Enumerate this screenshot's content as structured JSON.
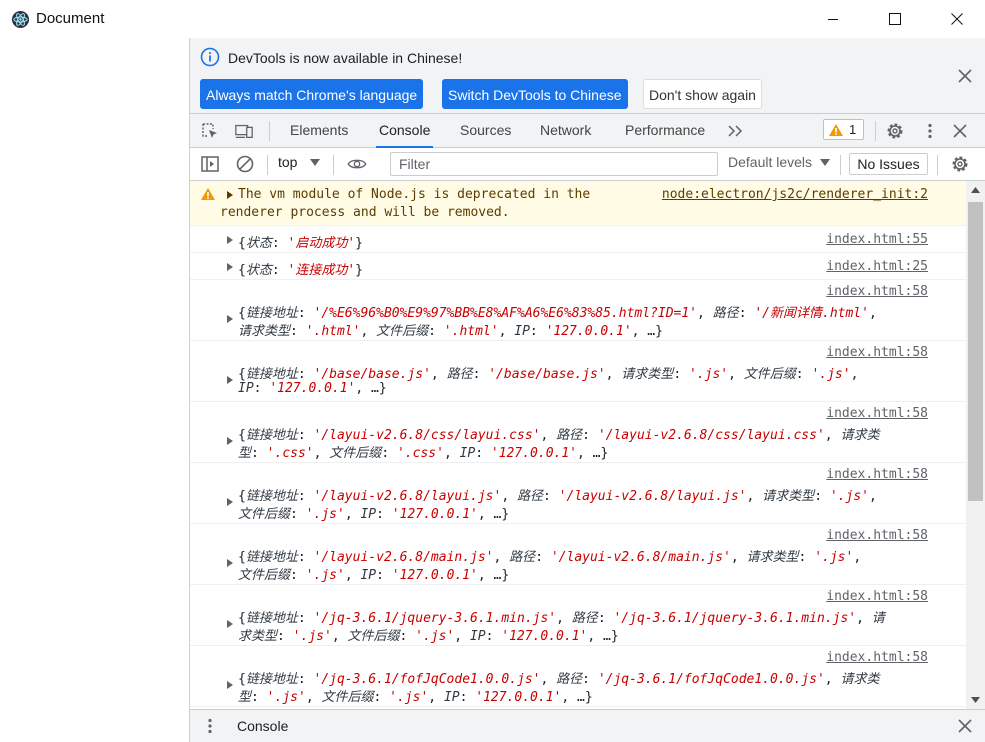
{
  "window": {
    "title": "Document"
  },
  "infobar": {
    "message": "DevTools is now available in Chinese!",
    "buttons": [
      "Always match Chrome's language",
      "Switch DevTools to Chinese",
      "Don't show again"
    ]
  },
  "toolbar": {
    "tabs": [
      "Elements",
      "Console",
      "Sources",
      "Network",
      "Performance"
    ],
    "active_tab": "Console",
    "warning_count": "1"
  },
  "filterbar": {
    "context": "top",
    "filter_placeholder": "Filter",
    "levels": "Default levels",
    "issues": "No Issues"
  },
  "console": {
    "warning": {
      "line1": "The vm module of Node.js is deprecated in the",
      "line2": "renderer process and will be removed.",
      "source": "node:electron/js2c/renderer_init:2"
    },
    "messages": [
      {
        "source": "index.html:55",
        "lines": [
          [
            "{",
            "k:状态",
            ": ",
            "s:'启动成功'",
            "}"
          ]
        ]
      },
      {
        "source": "index.html:25",
        "lines": [
          [
            "{",
            "k:状态",
            ": ",
            "s:'连接成功'",
            "}"
          ]
        ]
      },
      {
        "source": "index.html:58",
        "lines": [
          [
            "{",
            "k:链接地址",
            ": ",
            "s:'/%E6%96%B0%E9%97%BB%E8%AF%A6%E6%83%85.html?ID=1'",
            ", ",
            "k:路径",
            ": ",
            "s:'/新闻详情.html'",
            ","
          ],
          [
            "k:请求类型",
            ": ",
            "s:'.html'",
            ", ",
            "k:文件后缀",
            ": ",
            "s:'.html'",
            ", ",
            "k:IP",
            ": ",
            "s:'127.0.0.1'",
            ", …}"
          ]
        ]
      },
      {
        "source": "index.html:58",
        "lines": [
          [
            "{",
            "k:链接地址",
            ": ",
            "s:'/base/base.js'",
            ", ",
            "k:路径",
            ": ",
            "s:'/base/base.js'",
            ", ",
            "k:请求类型",
            ": ",
            "s:'.js'",
            ", ",
            "k:文件后缀",
            ": ",
            "s:'.js'",
            ","
          ],
          [
            "k:IP",
            ": ",
            "s:'127.0.0.1'",
            ", …}"
          ]
        ]
      },
      {
        "source": "index.html:58",
        "lines": [
          [
            "{",
            "k:链接地址",
            ": ",
            "s:'/layui-v2.6.8/css/layui.css'",
            ", ",
            "k:路径",
            ": ",
            "s:'/layui-v2.6.8/css/layui.css'",
            ", ",
            "k:请求类"
          ],
          [
            "k:型",
            ": ",
            "s:'.css'",
            ", ",
            "k:文件后缀",
            ": ",
            "s:'.css'",
            ", ",
            "k:IP",
            ": ",
            "s:'127.0.0.1'",
            ", …}"
          ]
        ]
      },
      {
        "source": "index.html:58",
        "lines": [
          [
            "{",
            "k:链接地址",
            ": ",
            "s:'/layui-v2.6.8/layui.js'",
            ", ",
            "k:路径",
            ": ",
            "s:'/layui-v2.6.8/layui.js'",
            ", ",
            "k:请求类型",
            ": ",
            "s:'.js'",
            ","
          ],
          [
            "k:文件后缀",
            ": ",
            "s:'.js'",
            ", ",
            "k:IP",
            ": ",
            "s:'127.0.0.1'",
            ", …}"
          ]
        ]
      },
      {
        "source": "index.html:58",
        "lines": [
          [
            "{",
            "k:链接地址",
            ": ",
            "s:'/layui-v2.6.8/main.js'",
            ", ",
            "k:路径",
            ": ",
            "s:'/layui-v2.6.8/main.js'",
            ", ",
            "k:请求类型",
            ": ",
            "s:'.js'",
            ","
          ],
          [
            "k:文件后缀",
            ": ",
            "s:'.js'",
            ", ",
            "k:IP",
            ": ",
            "s:'127.0.0.1'",
            ", …}"
          ]
        ]
      },
      {
        "source": "index.html:58",
        "lines": [
          [
            "{",
            "k:链接地址",
            ": ",
            "s:'/jq-3.6.1/jquery-3.6.1.min.js'",
            ", ",
            "k:路径",
            ": ",
            "s:'/jq-3.6.1/jquery-3.6.1.min.js'",
            ", ",
            "k:请"
          ],
          [
            "k:求类型",
            ": ",
            "s:'.js'",
            ", ",
            "k:文件后缀",
            ": ",
            "s:'.js'",
            ", ",
            "k:IP",
            ": ",
            "s:'127.0.0.1'",
            ", …}"
          ]
        ]
      },
      {
        "source": "index.html:58",
        "lines": [
          [
            "{",
            "k:链接地址",
            ": ",
            "s:'/jq-3.6.1/fofJqCode1.0.0.js'",
            ", ",
            "k:路径",
            ": ",
            "s:'/jq-3.6.1/fofJqCode1.0.0.js'",
            ", ",
            "k:请求类"
          ],
          [
            "k:型",
            ": ",
            "s:'.js'",
            ", ",
            "k:文件后缀",
            ": ",
            "s:'.js'",
            ", ",
            "k:IP",
            ": ",
            "s:'127.0.0.1'",
            ", …}"
          ]
        ]
      }
    ]
  },
  "drawer": {
    "tab": "Console"
  },
  "colors": {
    "accent": "#1a73e8",
    "string": "#c80000",
    "warning_bg": "#fffbe5",
    "warning_icon": "#f29900"
  }
}
